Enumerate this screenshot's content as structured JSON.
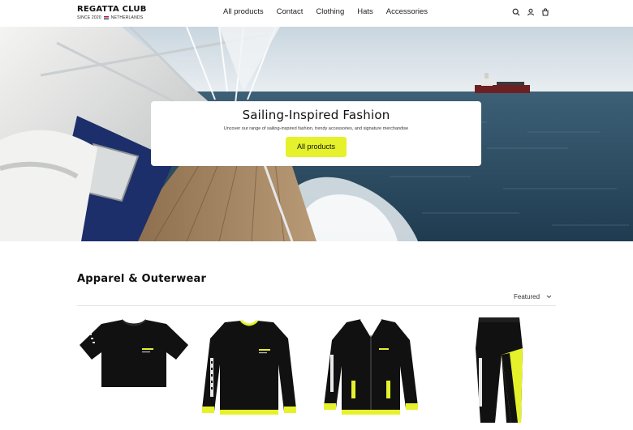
{
  "brand": {
    "name": "REGATTA CLUB",
    "since": "SINCE 2020",
    "country": "NETHERLANDS"
  },
  "nav": {
    "items": [
      {
        "label": "All products"
      },
      {
        "label": "Contact"
      },
      {
        "label": "Clothing"
      },
      {
        "label": "Hats"
      },
      {
        "label": "Accessories"
      }
    ]
  },
  "header_icons": [
    "search-icon",
    "account-icon",
    "cart-icon"
  ],
  "hero": {
    "title": "Sailing-Inspired Fashion",
    "subtitle": "Uncover our range of sailing-inspired fashion, trendy accessories, and signature merchandise",
    "button_label": "All products"
  },
  "collection": {
    "title": "Apparel & Outerwear",
    "sort_label": "Featured",
    "products": [
      {
        "type": "t-shirt"
      },
      {
        "type": "sweatshirt"
      },
      {
        "type": "bomber-jacket"
      },
      {
        "type": "leggings"
      }
    ]
  },
  "colors": {
    "accent": "#e5f12b",
    "garment": "#111111",
    "sea": "#2f5068",
    "sky": "#d9e3ea"
  }
}
